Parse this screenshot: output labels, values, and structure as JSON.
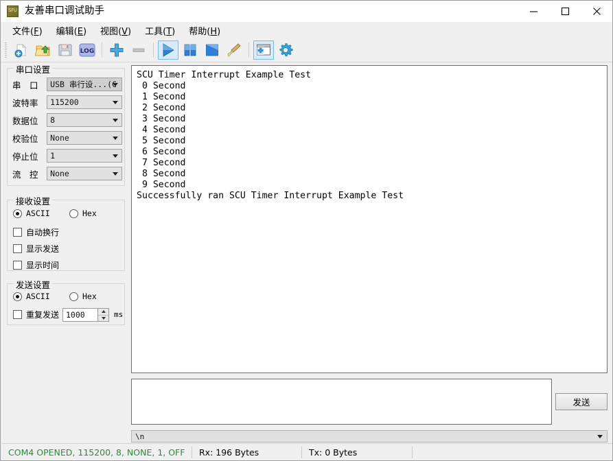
{
  "window": {
    "title": "友善串口调试助手",
    "icon": "app-icon",
    "minimize_label": "—",
    "maximize_label": "☐",
    "close_label": "✕"
  },
  "menubar": [
    {
      "name": "file",
      "label": "文件",
      "accel": "F"
    },
    {
      "name": "edit",
      "label": "编辑",
      "accel": "E"
    },
    {
      "name": "view",
      "label": "视图",
      "accel": "V"
    },
    {
      "name": "tools",
      "label": "工具",
      "accel": "T"
    },
    {
      "name": "help",
      "label": "帮助",
      "accel": "H"
    }
  ],
  "toolbar": {
    "items": [
      {
        "name": "new-file-icon",
        "title": "新建",
        "selected": false
      },
      {
        "name": "open-folder-icon",
        "title": "打开",
        "selected": false
      },
      {
        "name": "save-disk-icon",
        "title": "保存",
        "selected": false
      },
      {
        "name": "log-icon",
        "title": "LOG",
        "label": "LOG",
        "selected": false
      },
      {
        "name": "add-port-icon",
        "title": "添加",
        "selected": false
      },
      {
        "name": "remove-port-icon",
        "title": "移除",
        "selected": false,
        "disabled": true
      },
      {
        "name": "play-icon",
        "title": "打开串口",
        "selected": true
      },
      {
        "name": "pause-icon",
        "title": "暂停",
        "selected": false
      },
      {
        "name": "stop-icon",
        "title": "停止",
        "selected": false
      },
      {
        "name": "broom-clear-icon",
        "title": "清空",
        "selected": false
      },
      {
        "name": "new-window-icon",
        "title": "新窗口",
        "selected": true
      },
      {
        "name": "gear-settings-icon",
        "title": "设置",
        "selected": false
      }
    ]
  },
  "serial_settings": {
    "title": "串口设置",
    "fields": [
      {
        "name": "port",
        "label": "串　口",
        "value": "USB 串行设...(C",
        "greyed": true
      },
      {
        "name": "baudrate",
        "label": "波特率",
        "value": "115200",
        "greyed": false
      },
      {
        "name": "databits",
        "label": "数据位",
        "value": "8",
        "greyed": false
      },
      {
        "name": "parity",
        "label": "校验位",
        "value": "None",
        "greyed": false
      },
      {
        "name": "stopbits",
        "label": "停止位",
        "value": "1",
        "greyed": false
      },
      {
        "name": "flowcontrol",
        "label": "流　控",
        "value": "None",
        "greyed": false
      }
    ]
  },
  "receive_settings": {
    "title": "接收设置",
    "format_ascii": {
      "label": "ASCII",
      "checked": true
    },
    "format_hex": {
      "label": "Hex",
      "checked": false
    },
    "auto_wrap": {
      "label": "自动换行",
      "checked": false
    },
    "show_send": {
      "label": "显示发送",
      "checked": false
    },
    "show_time": {
      "label": "显示时间",
      "checked": false
    }
  },
  "send_settings": {
    "title": "发送设置",
    "format_ascii": {
      "label": "ASCII",
      "checked": true
    },
    "format_hex": {
      "label": "Hex",
      "checked": false
    },
    "repeat_send": {
      "label": "重复发送",
      "checked": false
    },
    "interval_value": "1000",
    "interval_unit": "ms"
  },
  "receive_area": {
    "text": "SCU Timer Interrupt Example Test\n 0 Second\n 1 Second\n 2 Second\n 3 Second\n 4 Second\n 5 Second\n 6 Second\n 7 Second\n 8 Second\n 9 Second\nSuccessfully ran SCU Timer Interrupt Example Test"
  },
  "send_area": {
    "value": "",
    "placeholder": "",
    "send_button_label": "发送",
    "eol_value": "\\n"
  },
  "statusbar": {
    "connection": "COM4 OPENED, 115200, 8, NONE, 1, OFF",
    "connection_color": "#2e8b3a",
    "rx": "Rx: 196 Bytes",
    "tx": "Tx: 0 Bytes",
    "extra": ""
  }
}
